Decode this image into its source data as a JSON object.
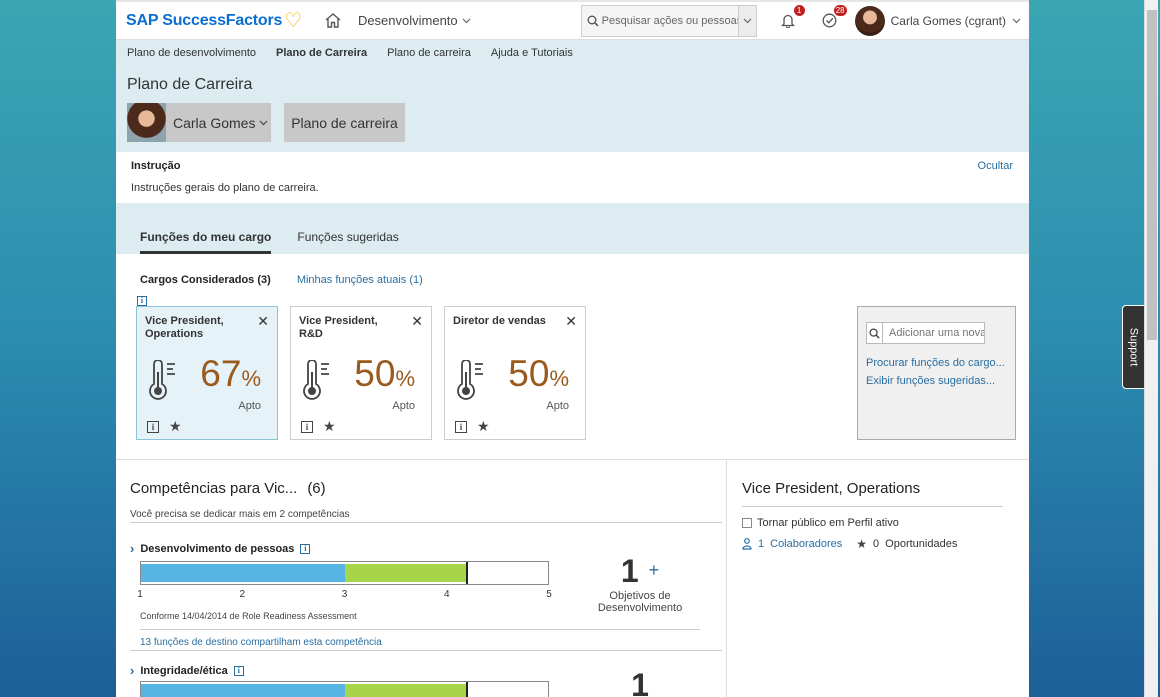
{
  "header": {
    "brand": "SAP SuccessFactors",
    "module": "Desenvolvimento",
    "search_placeholder": "Pesquisar ações ou pessoas",
    "notifications_count": "1",
    "todo_count": "28",
    "user_name": "Carla Gomes (cgrant)"
  },
  "subnav": {
    "items": [
      "Plano de desenvolvimento",
      "Plano de Carreira",
      "Plano de carreira",
      "Ajuda e Tutoriais"
    ]
  },
  "page": {
    "title": "Plano de Carreira",
    "person": "Carla Gomes",
    "plan": "Plano de carreira"
  },
  "instruction": {
    "title": "Instrução",
    "text": "Instruções gerais do plano de carreira.",
    "hide": "Ocultar"
  },
  "tabs": [
    "Funções do meu cargo",
    "Funções sugeridas"
  ],
  "roles": {
    "considered": "Cargos Considerados (3)",
    "current": "Minhas funções atuais (1)",
    "cards": [
      {
        "title": "Vice President, Operations",
        "percent": "67",
        "unit": "%",
        "label": "Apto"
      },
      {
        "title": "Vice President, R&D",
        "percent": "50",
        "unit": "%",
        "label": "Apto"
      },
      {
        "title": "Diretor de vendas",
        "percent": "50",
        "unit": "%",
        "label": "Apto"
      }
    ],
    "add_placeholder": "Adicionar uma nova",
    "browse_link": "Procurar funções do cargo...",
    "suggested_link": "Exibir funções sugeridas..."
  },
  "competencies": {
    "title": "Competências para Vic...",
    "count": "(6)",
    "subtitle": "Você precisa se dedicar mais em 2 competências",
    "items": [
      {
        "name": "Desenvolvimento de pessoas",
        "current": 3,
        "expected": 4.2,
        "ticks": [
          "1",
          "2",
          "3",
          "4",
          "5"
        ],
        "note": "Conforme 14/04/2014 de Role Readiness Assessment",
        "link": "13 funções de destino compartilham esta competência",
        "objectives_count": "1",
        "objectives_plus": "+",
        "objectives_label": "Objetivos de Desenvolvimento"
      },
      {
        "name": "Integridade/ética",
        "current": 3,
        "expected": 4.2,
        "objectives_count": "1"
      }
    ]
  },
  "role_detail": {
    "title": "Vice President, Operations",
    "public_label": "Tornar público em Perfil ativo",
    "collaborators_count": "1",
    "collaborators_label": "Colaboradores",
    "opportunities_count": "0",
    "opportunities_label": "Oportunidades"
  },
  "support_label": "Support"
}
